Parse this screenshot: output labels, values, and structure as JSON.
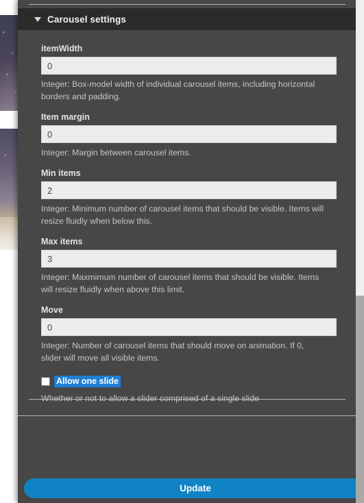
{
  "background": {
    "thumbnails": [
      "night-sky-thumbnail",
      "landscape-thumbnail",
      "beach-thumbnail"
    ]
  },
  "panel": {
    "section": {
      "title": "Carousel settings",
      "disclosure_state": "expanded",
      "disclosure_glyph": "▼"
    },
    "fields": [
      {
        "name": "item-width",
        "label": "itemWidth",
        "value": "0",
        "description": "Integer: Box-model width of individual carousel items, including horizontal borders and padding."
      },
      {
        "name": "item-margin",
        "label": "Item margin",
        "value": "0",
        "description": "Integer: Margin between carousel items."
      },
      {
        "name": "min-items",
        "label": "Min items",
        "value": "2",
        "description": "Integer: Minimum number of carousel items that should be visible. Items will resize fluidly when below this."
      },
      {
        "name": "max-items",
        "label": "Max items",
        "value": "3",
        "description": "Integer: Maxmimum number of carousel items that should be visible. Items will resize fluidly when above this limit."
      },
      {
        "name": "move",
        "label": "Move",
        "value": "0",
        "description": "Integer: Number of carousel items that should move on animation. If 0, slider will move all visible items."
      }
    ],
    "checkbox": {
      "name": "allow-one-slide",
      "label": "Allow one slide",
      "checked": false,
      "selected": true,
      "description": "Whether or not to allow a slider comprised of a single slide"
    },
    "footer": {
      "update_label": "Update"
    }
  },
  "colors": {
    "panel_background": "#474747",
    "section_header_background": "#2b2b2b",
    "input_background": "#ececec",
    "input_text": "#3b4654",
    "label_text": "#e4e4e4",
    "description_text": "#c6c6c6",
    "selection_highlight": "#1f7fd4",
    "primary_button": "#1083c4",
    "divider": "#b9b9b9",
    "scrollbar_track": "#efefef",
    "scrollbar_thumb": "#a9a9a9"
  }
}
